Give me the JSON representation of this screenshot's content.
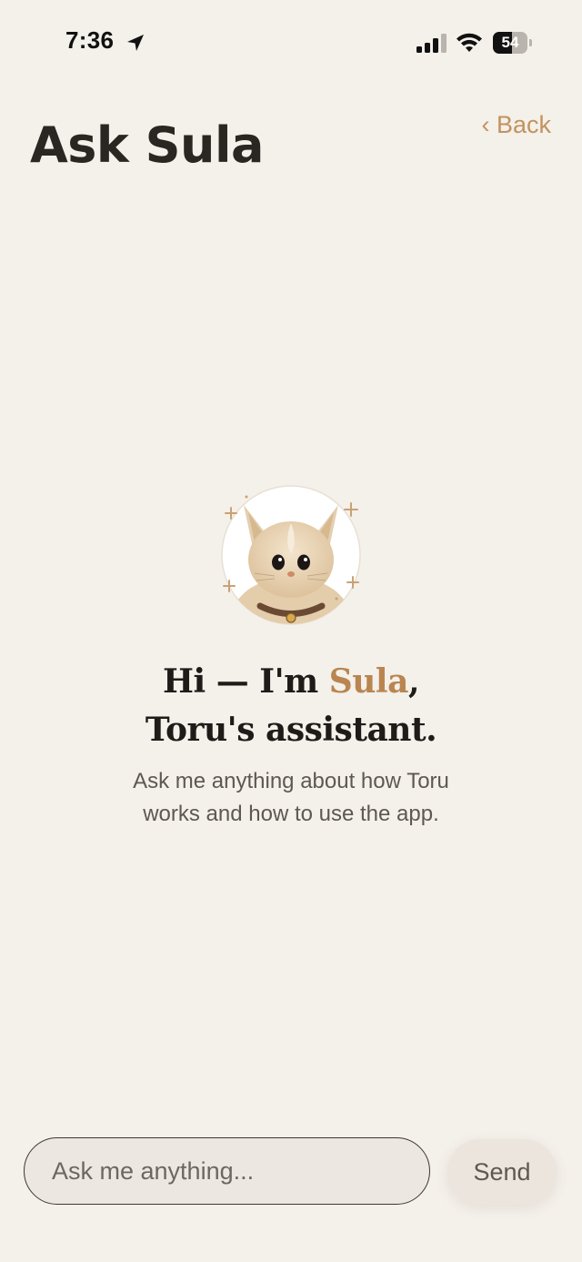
{
  "status_bar": {
    "time": "7:36",
    "battery_level": "54",
    "battery_fraction": 0.54,
    "icons": [
      "location-arrow-icon",
      "cellular-signal-icon",
      "wifi-icon",
      "battery-icon"
    ]
  },
  "header": {
    "back_label": "‹ Back",
    "title": "Ask Sula"
  },
  "assistant": {
    "avatar_icon": "cat-mascot-icon",
    "greeting_prefix": "Hi — I'm ",
    "greeting_name": "Sula",
    "greeting_suffix": ",",
    "greeting_line2": "Toru's assistant.",
    "subtitle_line1": "Ask me anything about how Toru",
    "subtitle_line2": "works and how to use the app."
  },
  "composer": {
    "input_value": "",
    "input_placeholder": "Ask me anything...",
    "send_label": "Send"
  },
  "colors": {
    "background": "#f4f0ea",
    "accent": "#c2935e",
    "accent_text": "#b98550",
    "title_text": "#2a2622",
    "body_text": "#5e5852"
  }
}
